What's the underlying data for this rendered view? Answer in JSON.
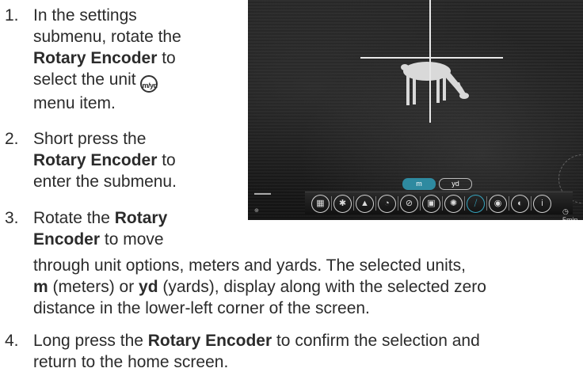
{
  "steps": [
    {
      "num": "1.",
      "l1": "In the settings",
      "l2": "submenu, rotate the",
      "l3_bold": "Rotary Encoder",
      "l3_rest": " to",
      "l4": "select the unit",
      "l5": "menu item."
    },
    {
      "num": "2.",
      "l1": "Short press the",
      "l2_bold": "Rotary Encoder",
      "l2_rest": " to",
      "l3": "enter the submenu."
    },
    {
      "num": "3.",
      "l1a": "Rotate the ",
      "l1_bold": "Rotary",
      "l2_bold": "Encoder",
      "l2_rest": " to move",
      "l3": "through unit options, meters and yards. The selected units,",
      "l4_bold1": "m",
      "l4_mid": " (meters) or ",
      "l4_bold2": "yd",
      "l4_rest": " (yards), display along with the selected zero",
      "l5": "distance in the lower-left corner of the screen."
    },
    {
      "num": "4.",
      "l1a": "Long press the ",
      "l1_bold": "Rotary Encoder",
      "l1_rest": " to confirm the selection and",
      "l2": "return to the home screen."
    }
  ],
  "unit_icon": {
    "text": "m/yd",
    "icon": "meters-yards-icon"
  },
  "screen": {
    "unit_options": [
      "m",
      "yd"
    ],
    "selected_unit": "m",
    "timer": "5min",
    "accent": "#36a3bd"
  }
}
